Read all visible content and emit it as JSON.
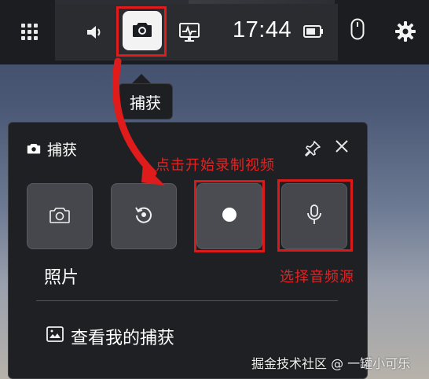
{
  "topbar": {
    "time": "17:44",
    "icons": [
      "widget-menu-icon",
      "volume-icon",
      "camera-icon",
      "performance-icon",
      "battery-icon",
      "mouse-icon",
      "settings-icon"
    ]
  },
  "tooltip": {
    "text": "捕获"
  },
  "panel": {
    "title": "捕获",
    "buttons": [
      {
        "name": "screenshot",
        "icon": "camera-icon"
      },
      {
        "name": "record-last",
        "icon": "replay-icon"
      },
      {
        "name": "start-recording",
        "icon": "record-dot-icon"
      },
      {
        "name": "microphone",
        "icon": "microphone-icon"
      }
    ],
    "photo_label": "照片",
    "view_captures": "查看我的捕获"
  },
  "annotations": {
    "record": "点击开始录制视频",
    "mic": "选择音频源"
  },
  "watermark": "掘金技术社区 @ 一罐小可乐",
  "colors": {
    "annotation_red": "#e52222",
    "panel_bg": "#1f2023",
    "button_bg": "#46474c"
  }
}
